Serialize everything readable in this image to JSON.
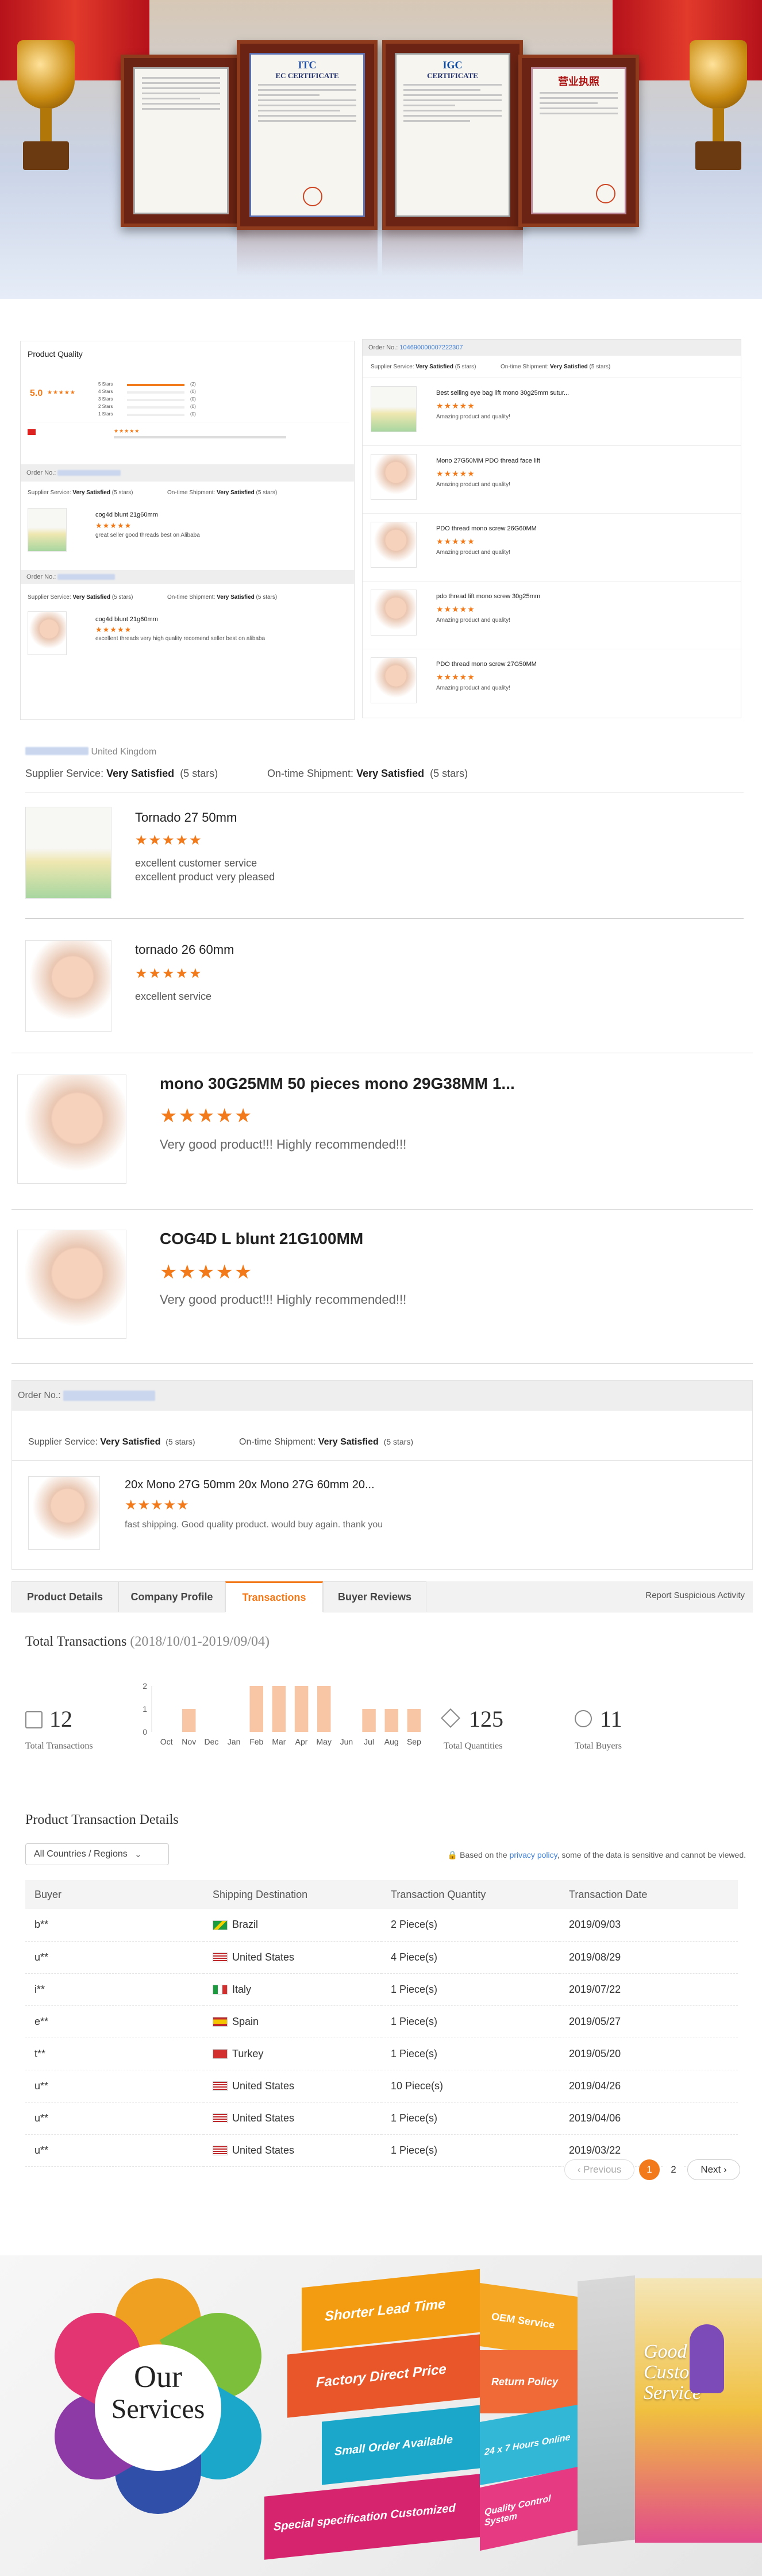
{
  "quality_screenshot": {
    "heading": "Product Quality",
    "rating": "5.0",
    "breakdown": [
      {
        "label": "5 Stars",
        "count": "(2)"
      },
      {
        "label": "4 Stars",
        "count": "(0)"
      },
      {
        "label": "3 Stars",
        "count": "(0)"
      },
      {
        "label": "2 Stars",
        "count": "(0)"
      },
      {
        "label": "1 Stars",
        "count": "(0)"
      }
    ],
    "order_label": "Order No.:",
    "supplier_service_label": "Supplier Service:",
    "supplier_service_value": "Very Satisfied",
    "supplier_stars": "(5 stars)",
    "shipment_label": "On-time Shipment:",
    "shipment_value": "Very Satisfied",
    "shipment_stars": "(5 stars)",
    "reviews": [
      {
        "product": "cog4d blunt 21g60mm",
        "text": "great seller good threads best on Alibaba"
      },
      {
        "product": "cog4d blunt 21g60mm",
        "text": "excellent threads very high quality recomend seller best on alibaba"
      }
    ]
  },
  "orders_screenshot": {
    "order_label": "Order No.:",
    "order_number": "104690000007222307",
    "supplier_service_label": "Supplier Service:",
    "supplier_service_value": "Very Satisfied",
    "supplier_stars": "(5 stars)",
    "shipment_label": "On-time Shipment:",
    "shipment_value": "Very Satisfied",
    "shipment_stars": "(5 stars)",
    "items": [
      {
        "product": "Best selling eye bag lift mono 30g25mm sutur...",
        "text": "Amazing product and quality!"
      },
      {
        "product": "Mono 27G50MM PDO thread face lift",
        "text": "Amazing product and quality!"
      },
      {
        "product": "PDO thread mono screw 26G60MM",
        "text": "Amazing product and quality!"
      },
      {
        "product": "pdo thread lift mono screw 30g25mm",
        "text": "Amazing product and quality!"
      },
      {
        "product": "PDO thread mono screw 27G50MM",
        "text": "Amazing product and quality!"
      }
    ]
  },
  "uk_review": {
    "country": "United Kingdom",
    "supplier_service_label": "Supplier Service:",
    "supplier_service_value": "Very Satisfied",
    "supplier_stars": "(5 stars)",
    "shipment_label": "On-time Shipment:",
    "shipment_value": "Very Satisfied",
    "shipment_stars": "(5 stars)",
    "items": [
      {
        "product": "Tornado 27 50mm",
        "lines": [
          "excellent customer service",
          "excellent product very pleased"
        ]
      },
      {
        "product": "tornado 26 60mm",
        "lines": [
          "excellent service",
          ""
        ]
      }
    ]
  },
  "big_reviews": [
    {
      "product": "mono 30G25MM 50 pieces mono 29G38MM 1...",
      "text": "Very good product!!! Highly recommended!!!"
    },
    {
      "product": "COG4D L blunt 21G100MM",
      "text": "Very good product!!! Highly recommended!!!"
    }
  ],
  "order_review": {
    "order_label": "Order No.:",
    "supplier_service_label": "Supplier Service:",
    "supplier_service_value": "Very Satisfied",
    "supplier_stars": "(5 stars)",
    "shipment_label": "On-time Shipment:",
    "shipment_value": "Very Satisfied",
    "shipment_stars": "(5 stars)",
    "product": "20x Mono 27G 50mm 20x Mono 27G 60mm 20...",
    "text": "fast shipping. Good quality product. would buy again. thank you"
  },
  "tabs": {
    "items": [
      "Product Details",
      "Company Profile",
      "Transactions",
      "Buyer Reviews"
    ],
    "active": "Transactions",
    "report_link": "Report Suspicious Activity"
  },
  "transactions": {
    "title": "Total Transactions",
    "period": "(2018/10/01-2019/09/04)",
    "total_transactions": "12",
    "total_transactions_label": "Total Transactions",
    "total_quantities": "125",
    "total_quantities_label": "Total Quantities",
    "total_buyers": "11",
    "total_buyers_label": "Total Buyers",
    "chart_data": {
      "type": "bar",
      "categories": [
        "Oct",
        "Nov",
        "Dec",
        "Jan",
        "Feb",
        "Mar",
        "Apr",
        "May",
        "Jun",
        "Jul",
        "Aug",
        "Sep"
      ],
      "values": [
        0,
        1,
        0,
        0,
        2,
        2,
        2,
        2,
        0,
        1,
        1,
        1
      ],
      "yticks": [
        "0",
        "1",
        "2"
      ],
      "ylim": [
        0,
        2
      ],
      "color": "#f8c6a5"
    }
  },
  "details": {
    "title": "Product Transaction Details",
    "region_select": "All Countries / Regions",
    "privacy_prefix": "Based on the",
    "privacy_link": "privacy policy",
    "privacy_suffix": ", some of the data is sensitive and cannot be viewed.",
    "columns": [
      "Buyer",
      "Shipping Destination",
      "Transaction Quantity",
      "Transaction Date"
    ],
    "rows": [
      {
        "buyer": "b**",
        "country": "Brazil",
        "flag": "br",
        "qty": "2 Piece(s)",
        "date": "2019/09/03"
      },
      {
        "buyer": "u**",
        "country": "United States",
        "flag": "us",
        "qty": "4 Piece(s)",
        "date": "2019/08/29"
      },
      {
        "buyer": "i**",
        "country": "Italy",
        "flag": "it",
        "qty": "1 Piece(s)",
        "date": "2019/07/22"
      },
      {
        "buyer": "e**",
        "country": "Spain",
        "flag": "es",
        "qty": "1 Piece(s)",
        "date": "2019/05/27"
      },
      {
        "buyer": "t**",
        "country": "Turkey",
        "flag": "tr",
        "qty": "1 Piece(s)",
        "date": "2019/05/20"
      },
      {
        "buyer": "u**",
        "country": "United States",
        "flag": "us",
        "qty": "10 Piece(s)",
        "date": "2019/04/26"
      },
      {
        "buyer": "u**",
        "country": "United States",
        "flag": "us",
        "qty": "1 Piece(s)",
        "date": "2019/04/06"
      },
      {
        "buyer": "u**",
        "country": "United States",
        "flag": "us",
        "qty": "1 Piece(s)",
        "date": "2019/03/22"
      }
    ],
    "pagination": {
      "previous": "Previous",
      "pages": [
        "1",
        "2"
      ],
      "current": "1",
      "next": "Next"
    }
  },
  "certificates": {
    "itc_logo": "ITC",
    "itc_title": "EC CERTIFICATE",
    "igc_logo": "IGC",
    "igc_title": "CERTIFICATE",
    "license_title": "营业执照"
  },
  "services": {
    "title_line1": "Our",
    "title_line2": "Services",
    "ribbons": [
      "Shorter Lead Time",
      "Factory Direct Price",
      "Small Order Available",
      "Special specification Customized"
    ],
    "side_labels": [
      "OEM Service",
      "Return Policy",
      "24 x 7 Hours Online",
      "Quality Control System"
    ],
    "good_service_line1": "Good",
    "good_service_line2": "Customer",
    "good_service_line3": "Service"
  },
  "colors": {
    "accent": "#f27a1a",
    "link": "#3d7fd9",
    "bar": "#f8c6a5"
  }
}
